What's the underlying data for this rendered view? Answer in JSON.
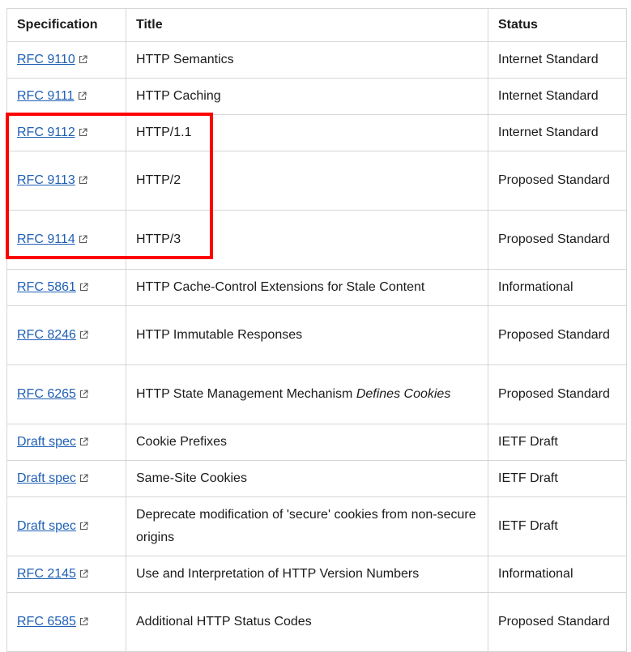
{
  "table": {
    "headers": [
      "Specification",
      "Title",
      "Status"
    ],
    "rows": [
      {
        "spec": "RFC 9110",
        "title": "HTTP Semantics",
        "title_em": "",
        "status": "Internet Standard"
      },
      {
        "spec": "RFC 9111",
        "title": "HTTP Caching",
        "title_em": "",
        "status": "Internet Standard"
      },
      {
        "spec": "RFC 9112",
        "title": "HTTP/1.1",
        "title_em": "",
        "status": "Internet Standard"
      },
      {
        "spec": "RFC 9113",
        "title": "HTTP/2",
        "title_em": "",
        "status": "Proposed Standard"
      },
      {
        "spec": "RFC 9114",
        "title": "HTTP/3",
        "title_em": "",
        "status": "Proposed Standard"
      },
      {
        "spec": "RFC 5861",
        "title": "HTTP Cache-Control Extensions for Stale Content",
        "title_em": "",
        "status": "Informational"
      },
      {
        "spec": "RFC 8246",
        "title": "HTTP Immutable Responses",
        "title_em": "",
        "status": "Proposed Standard"
      },
      {
        "spec": "RFC 6265",
        "title": "HTTP State Management Mechanism",
        "title_em": "Defines Cookies",
        "status": "Proposed Standard"
      },
      {
        "spec": "Draft spec",
        "title": "Cookie Prefixes",
        "title_em": "",
        "status": "IETF Draft"
      },
      {
        "spec": "Draft spec",
        "title": "Same-Site Cookies",
        "title_em": "",
        "status": "IETF Draft"
      },
      {
        "spec": "Draft spec",
        "title": "Deprecate modification of 'secure' cookies from non-secure origins",
        "title_em": "",
        "status": "IETF Draft"
      },
      {
        "spec": "RFC 2145",
        "title": "Use and Interpretation of HTTP Version Numbers",
        "title_em": "",
        "status": "Informational"
      },
      {
        "spec": "RFC 6585",
        "title": "Additional HTTP Status Codes",
        "title_em": "",
        "status": "Proposed Standard"
      }
    ]
  },
  "colors": {
    "link": "#1f5fb4",
    "highlight": "#ff0000",
    "border": "#d6d6d6"
  },
  "icons": {
    "link_icon": "external-link-icon"
  }
}
